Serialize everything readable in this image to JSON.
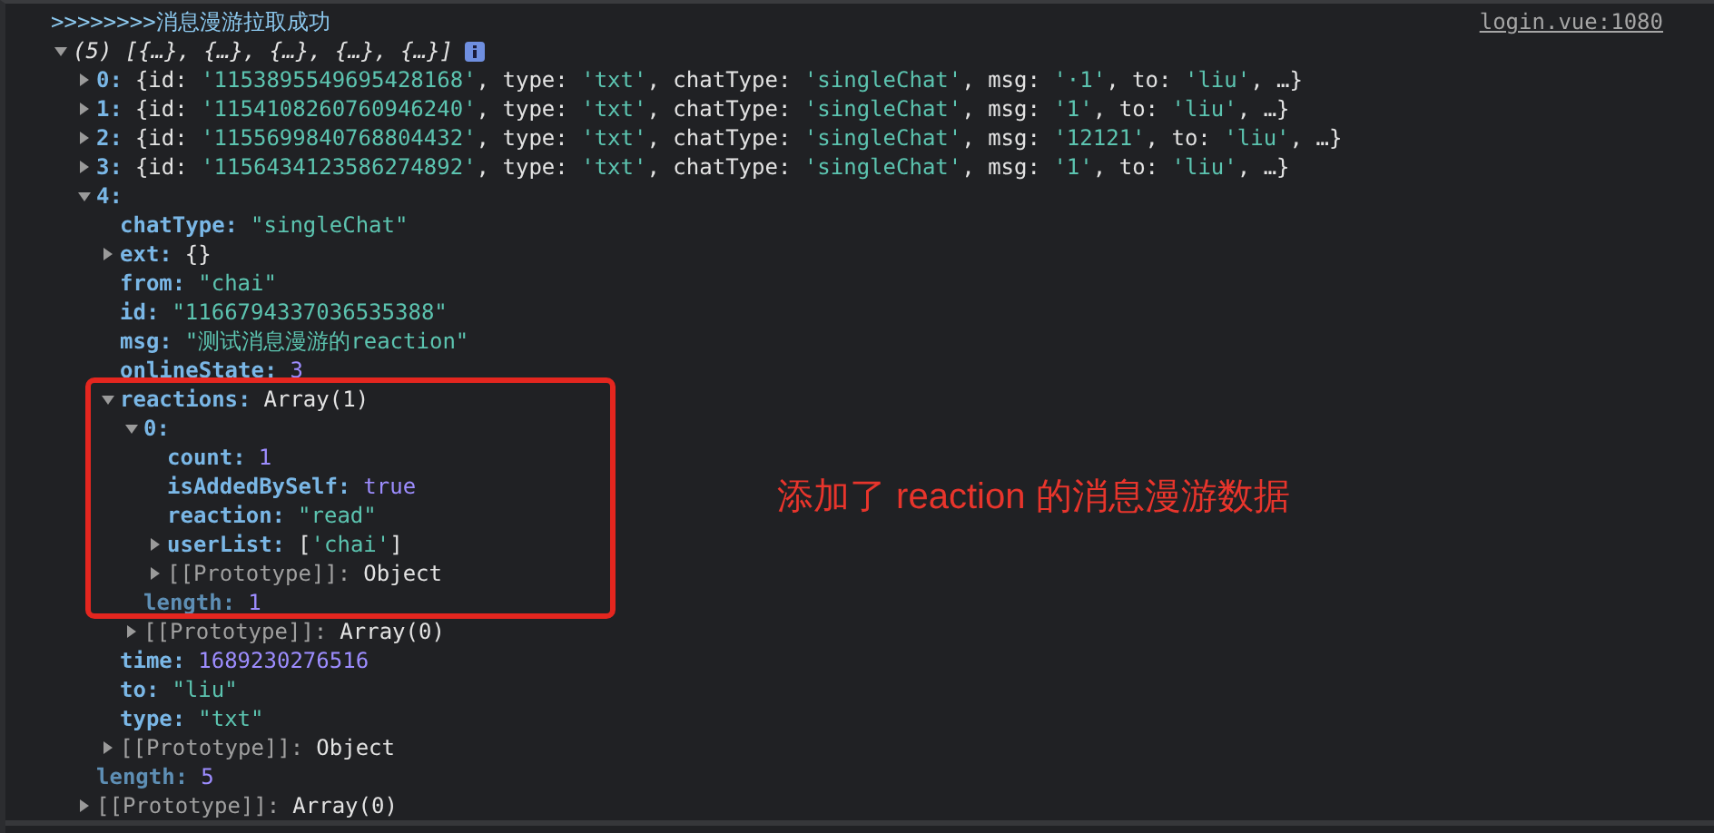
{
  "console": {
    "message": ">>>>>>>>消息漫游拉取成功",
    "source": "login.vue:1080",
    "tree": {
      "expanded": true,
      "info": true,
      "value": [
        {
          "kind": "summary",
          "text": "(5) [{…}, {…}, {…}, {…}, {…}]"
        }
      ],
      "children": [
        {
          "key": "0:",
          "kind": "own",
          "expanded": false,
          "value": [
            {
              "kind": "plain",
              "text": "{id: "
            },
            {
              "kind": "string",
              "text": "'1153895549695428168'"
            },
            {
              "kind": "plain",
              "text": ", type: "
            },
            {
              "kind": "string",
              "text": "'txt'"
            },
            {
              "kind": "plain",
              "text": ", chatType: "
            },
            {
              "kind": "string",
              "text": "'singleChat'"
            },
            {
              "kind": "plain",
              "text": ", msg: "
            },
            {
              "kind": "string",
              "text": "'·1'"
            },
            {
              "kind": "plain",
              "text": ", to: "
            },
            {
              "kind": "string",
              "text": "'liu'"
            },
            {
              "kind": "plain",
              "text": ", …}"
            }
          ]
        },
        {
          "key": "1:",
          "kind": "own",
          "expanded": false,
          "value": [
            {
              "kind": "plain",
              "text": "{id: "
            },
            {
              "kind": "string",
              "text": "'1154108260760946240'"
            },
            {
              "kind": "plain",
              "text": ", type: "
            },
            {
              "kind": "string",
              "text": "'txt'"
            },
            {
              "kind": "plain",
              "text": ", chatType: "
            },
            {
              "kind": "string",
              "text": "'singleChat'"
            },
            {
              "kind": "plain",
              "text": ", msg: "
            },
            {
              "kind": "string",
              "text": "'1'"
            },
            {
              "kind": "plain",
              "text": ", to: "
            },
            {
              "kind": "string",
              "text": "'liu'"
            },
            {
              "kind": "plain",
              "text": ", …}"
            }
          ]
        },
        {
          "key": "2:",
          "kind": "own",
          "expanded": false,
          "value": [
            {
              "kind": "plain",
              "text": "{id: "
            },
            {
              "kind": "string",
              "text": "'1155699840768804432'"
            },
            {
              "kind": "plain",
              "text": ", type: "
            },
            {
              "kind": "string",
              "text": "'txt'"
            },
            {
              "kind": "plain",
              "text": ", chatType: "
            },
            {
              "kind": "string",
              "text": "'singleChat'"
            },
            {
              "kind": "plain",
              "text": ", msg: "
            },
            {
              "kind": "string",
              "text": "'12121'"
            },
            {
              "kind": "plain",
              "text": ", to: "
            },
            {
              "kind": "string",
              "text": "'liu'"
            },
            {
              "kind": "plain",
              "text": ", …}"
            }
          ]
        },
        {
          "key": "3:",
          "kind": "own",
          "expanded": false,
          "value": [
            {
              "kind": "plain",
              "text": "{id: "
            },
            {
              "kind": "string",
              "text": "'1156434123586274892'"
            },
            {
              "kind": "plain",
              "text": ", type: "
            },
            {
              "kind": "string",
              "text": "'txt'"
            },
            {
              "kind": "plain",
              "text": ", chatType: "
            },
            {
              "kind": "string",
              "text": "'singleChat'"
            },
            {
              "kind": "plain",
              "text": ", msg: "
            },
            {
              "kind": "string",
              "text": "'1'"
            },
            {
              "kind": "plain",
              "text": ", to: "
            },
            {
              "kind": "string",
              "text": "'liu'"
            },
            {
              "kind": "plain",
              "text": ", …}"
            }
          ]
        },
        {
          "key": "4:",
          "kind": "own",
          "expanded": true,
          "children": [
            {
              "key": "chatType:",
              "kind": "own",
              "value": [
                {
                  "kind": "string",
                  "text": "\"singleChat\""
                }
              ]
            },
            {
              "key": "ext:",
              "kind": "own",
              "expanded": false,
              "value": [
                {
                  "kind": "plain",
                  "text": "{}"
                }
              ]
            },
            {
              "key": "from:",
              "kind": "own",
              "value": [
                {
                  "kind": "string",
                  "text": "\"chai\""
                }
              ]
            },
            {
              "key": "id:",
              "kind": "own",
              "value": [
                {
                  "kind": "string",
                  "text": "\"1166794337036535388\""
                }
              ]
            },
            {
              "key": "msg:",
              "kind": "own",
              "value": [
                {
                  "kind": "string",
                  "text": "\"测试消息漫游的reaction\""
                }
              ]
            },
            {
              "key": "onlineState:",
              "kind": "own",
              "value": [
                {
                  "kind": "number",
                  "text": "3"
                }
              ]
            },
            {
              "key": "reactions:",
              "kind": "own",
              "expanded": true,
              "highlighted": true,
              "value": [
                {
                  "kind": "plain",
                  "text": "Array(1)"
                }
              ],
              "children": [
                {
                  "key": "0:",
                  "kind": "own",
                  "expanded": true,
                  "children": [
                    {
                      "key": "count:",
                      "kind": "own",
                      "value": [
                        {
                          "kind": "number",
                          "text": "1"
                        }
                      ]
                    },
                    {
                      "key": "isAddedBySelf:",
                      "kind": "own",
                      "value": [
                        {
                          "kind": "number",
                          "text": "true"
                        }
                      ]
                    },
                    {
                      "key": "reaction:",
                      "kind": "own",
                      "value": [
                        {
                          "kind": "string",
                          "text": "\"read\""
                        }
                      ]
                    },
                    {
                      "key": "userList:",
                      "kind": "own",
                      "expanded": false,
                      "value": [
                        {
                          "kind": "plain",
                          "text": "["
                        },
                        {
                          "kind": "string",
                          "text": "'chai'"
                        },
                        {
                          "kind": "plain",
                          "text": "]"
                        }
                      ]
                    },
                    {
                      "key": "[[Prototype]]:",
                      "kind": "internal",
                      "expanded": false,
                      "value": [
                        {
                          "kind": "plain",
                          "text": "Object"
                        }
                      ]
                    }
                  ]
                },
                {
                  "key": "length:",
                  "kind": "hidden",
                  "value": [
                    {
                      "kind": "number",
                      "text": "1"
                    }
                  ]
                },
                {
                  "key": "[[Prototype]]:",
                  "kind": "internal",
                  "expanded": false,
                  "value": [
                    {
                      "kind": "plain",
                      "text": "Array(0)"
                    }
                  ]
                }
              ]
            },
            {
              "key": "time:",
              "kind": "own",
              "value": [
                {
                  "kind": "number",
                  "text": "1689230276516"
                }
              ]
            },
            {
              "key": "to:",
              "kind": "own",
              "value": [
                {
                  "kind": "string",
                  "text": "\"liu\""
                }
              ]
            },
            {
              "key": "type:",
              "kind": "own",
              "value": [
                {
                  "kind": "string",
                  "text": "\"txt\""
                }
              ]
            },
            {
              "key": "[[Prototype]]:",
              "kind": "internal",
              "expanded": false,
              "value": [
                {
                  "kind": "plain",
                  "text": "Object"
                }
              ]
            }
          ]
        },
        {
          "key": "length:",
          "kind": "hidden",
          "value": [
            {
              "kind": "number",
              "text": "5"
            }
          ]
        },
        {
          "key": "[[Prototype]]:",
          "kind": "internal",
          "expanded": false,
          "value": [
            {
              "kind": "plain",
              "text": "Array(0)"
            }
          ]
        }
      ]
    }
  },
  "annotation": {
    "text": "添加了 reaction 的消息漫游数据"
  }
}
